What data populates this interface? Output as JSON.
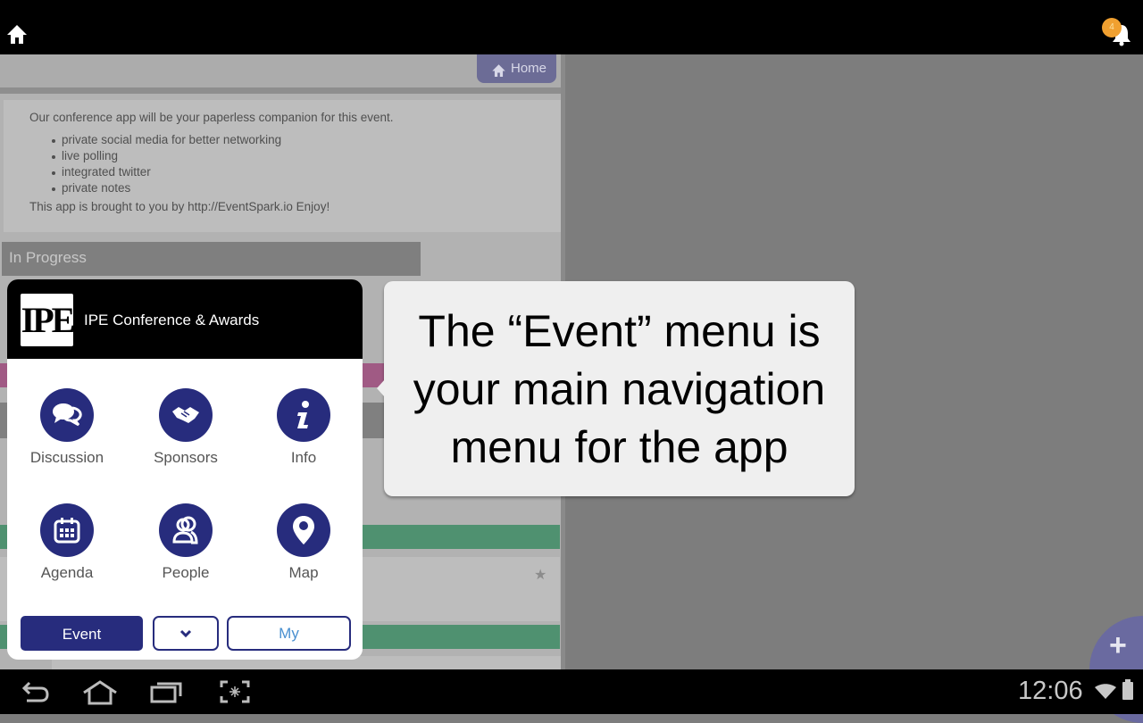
{
  "topbar": {
    "home_icon": "home-icon",
    "notifications": {
      "icon": "bell-icon",
      "badge_count": "4",
      "badge_color": "#f0a030"
    }
  },
  "panel": {
    "home_tab_label": "Home",
    "intro": {
      "lead": "Our conference app will be your paperless companion for this event.",
      "bullets": [
        "private social media for better networking",
        "live polling",
        "integrated twitter",
        "private notes"
      ],
      "footer": "This app is brought to you by http://EventSpark.io Enjoy!"
    },
    "section_label": "In Progress"
  },
  "menu": {
    "logo_text": "IPE",
    "title": "IPE Conference & Awards",
    "accent_color": "#272c7d",
    "items": [
      {
        "label": "Discussion",
        "icon": "chat-bubbles-icon"
      },
      {
        "label": "Sponsors",
        "icon": "handshake-icon"
      },
      {
        "label": "Info",
        "icon": "info-icon"
      },
      {
        "label": "Agenda",
        "icon": "calendar-icon"
      },
      {
        "label": "People",
        "icon": "people-icon"
      },
      {
        "label": "Map",
        "icon": "map-pin-icon"
      }
    ],
    "buttons": {
      "event": "Event",
      "expand_icon": "chevron-down-icon",
      "my": "My"
    }
  },
  "tooltip": {
    "line1": "The “Event” menu is",
    "line2": "your main navigation",
    "line3": "menu for the app"
  },
  "fab": {
    "icon": "plus-icon"
  },
  "statusbar": {
    "time": "12:06",
    "nav_icons": [
      "back-icon",
      "home-icon",
      "recent-apps-icon",
      "screenshot-icon"
    ]
  }
}
